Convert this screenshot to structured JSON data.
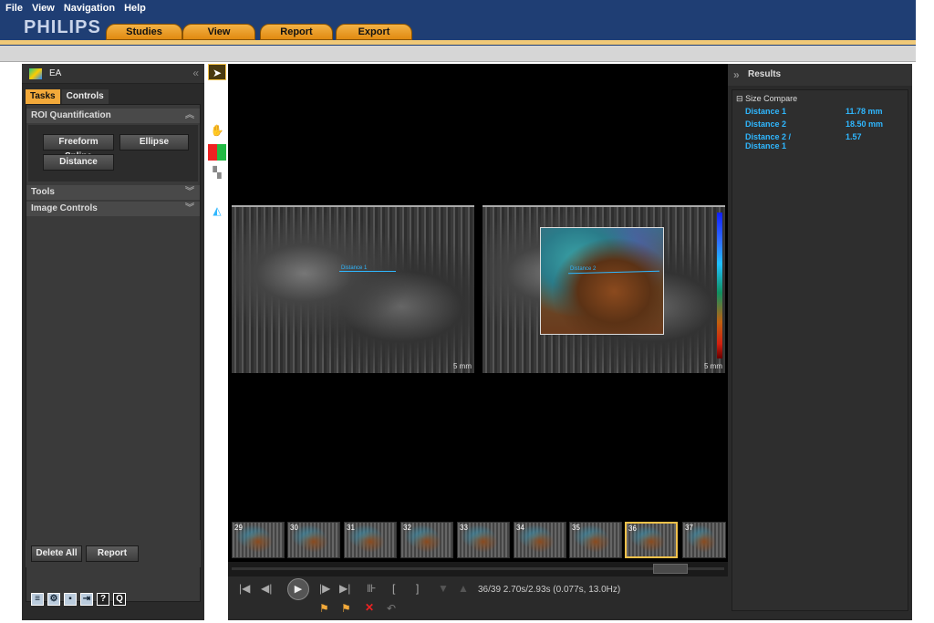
{
  "menu": [
    "File",
    "View",
    "Navigation",
    "Help"
  ],
  "brand": "PHILIPS",
  "nav_tabs": [
    "Studies",
    "View",
    "Report",
    "Export"
  ],
  "left_panel": {
    "app_label": "EA",
    "tabs": [
      "Tasks",
      "Controls"
    ],
    "sections": {
      "roi": "ROI Quantification",
      "tools": "Tools",
      "image_controls": "Image Controls"
    },
    "roi_buttons": [
      "Freeform Spline",
      "Ellipse",
      "Distance"
    ],
    "bottom_buttons": [
      "Delete All",
      "Report"
    ]
  },
  "viewer": {
    "scale_left": "5 mm",
    "scale_right": "5 mm",
    "meas_left": "Distance 1",
    "meas_right": "Distance 2"
  },
  "thumbnails": [
    "29",
    "30",
    "31",
    "32",
    "33",
    "34",
    "35",
    "36",
    "37"
  ],
  "selected_thumbnail": "36",
  "transport": {
    "frame_info": "36/39  2.70s/2.93s (0.077s, 13.0Hz)"
  },
  "results": {
    "title": "Results",
    "group": "Size Compare",
    "rows": [
      {
        "label": "Distance 1",
        "value": "11.78 mm"
      },
      {
        "label": "Distance 2",
        "value": "18.50 mm"
      },
      {
        "label": "Distance 2 /",
        "value": "1.57"
      },
      {
        "label": "Distance 1",
        "value": ""
      }
    ]
  },
  "colors": {
    "header_bg": "#1f3e74",
    "accent_orange": "#e18a10",
    "measure_blue": "#2fb7ff",
    "selection_gold": "#f2c14a"
  }
}
